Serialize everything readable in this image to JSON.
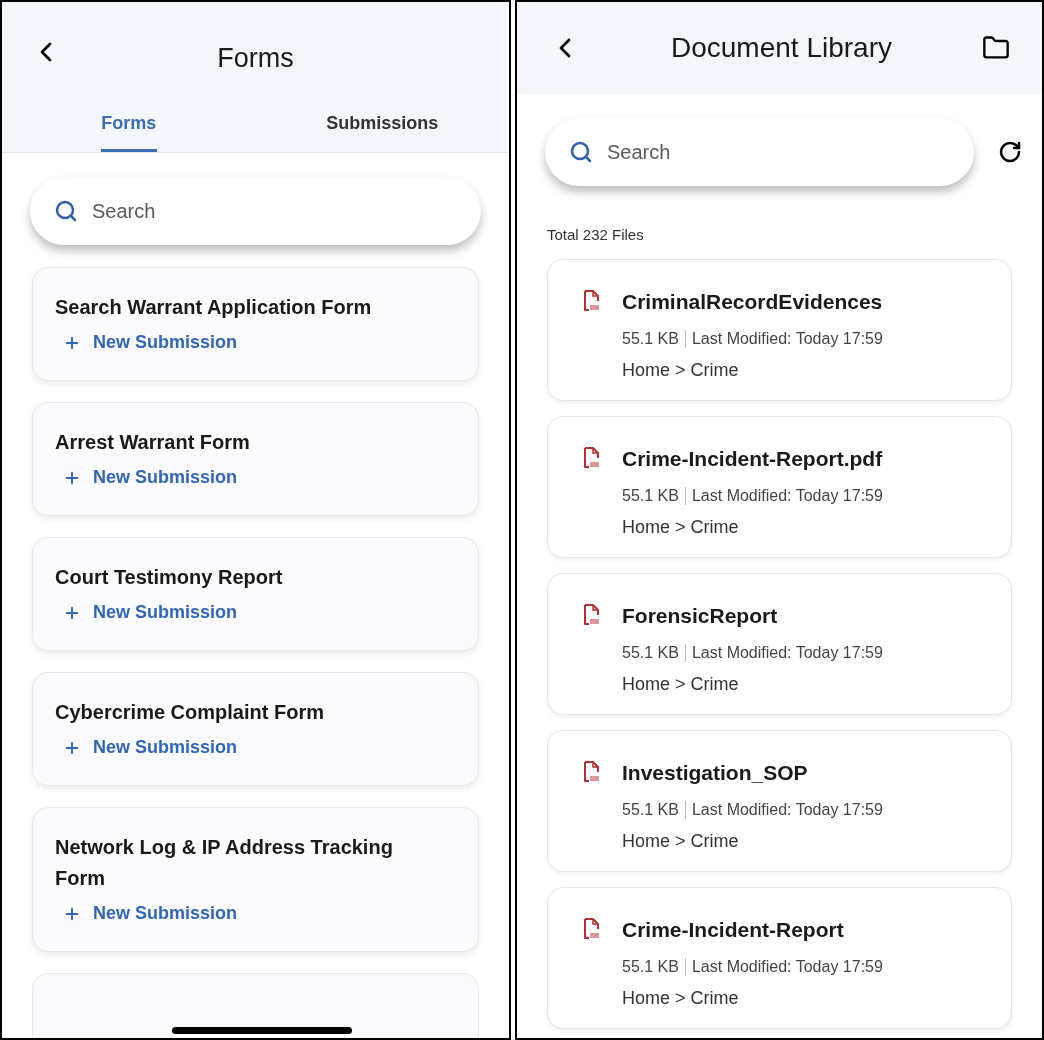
{
  "forms_screen": {
    "title": "Forms",
    "tabs": [
      {
        "label": "Forms",
        "selected": true
      },
      {
        "label": "Submissions",
        "selected": false
      }
    ],
    "search": {
      "placeholder": "Search"
    },
    "forms": [
      {
        "title": "Search Warrant Application Form",
        "action": "New Submission"
      },
      {
        "title": "Arrest Warrant Form",
        "action": "New Submission"
      },
      {
        "title": "Court Testimony Report",
        "action": "New Submission"
      },
      {
        "title": "Cybercrime Complaint Form",
        "action": "New Submission"
      },
      {
        "title": "Network Log & IP Address Tracking Form",
        "action": "New Submission"
      }
    ]
  },
  "library_screen": {
    "title": "Document Library",
    "search": {
      "placeholder": "Search"
    },
    "total": "Total 232 Files",
    "files": [
      {
        "name": "CriminalRecordEvidences",
        "size": "55.1 KB",
        "modified": "Last Modified: Today 17:59",
        "path": "Home > Crime"
      },
      {
        "name": "Crime-Incident-Report.pdf",
        "size": "55.1 KB",
        "modified": "Last Modified: Today 17:59",
        "path": "Home > Crime"
      },
      {
        "name": "ForensicReport",
        "size": "55.1 KB",
        "modified": "Last Modified: Today 17:59",
        "path": "Home > Crime"
      },
      {
        "name": "Investigation_SOP",
        "size": "55.1 KB",
        "modified": "Last Modified: Today 17:59",
        "path": "Home > Crime"
      },
      {
        "name": "Crime-Incident-Report",
        "size": "55.1 KB",
        "modified": "Last Modified: Today 17:59",
        "path": "Home > Crime"
      }
    ]
  }
}
